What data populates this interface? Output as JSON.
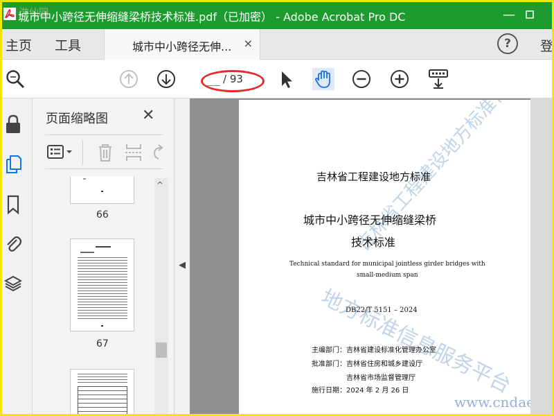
{
  "window": {
    "title": "城市中小跨径无伸缩缝梁桥技术标准.pdf（已加密） - Adobe Acrobat Pro DC",
    "minimize_icon": "minimize-icon",
    "maximize_icon": "maximize-icon",
    "overlay_watermark": "游仙园"
  },
  "menu": {
    "home": "主页",
    "tools": "工具",
    "tab_title": "城市中小跨径无伸...",
    "tab_close": "×",
    "help": "?",
    "login": "登"
  },
  "toolbar": {
    "page_current": "",
    "page_total": "/ 93",
    "icons": [
      "search-icon",
      "prev-page-icon",
      "next-page-icon",
      "select-arrow-icon",
      "hand-tool-icon",
      "zoom-out-icon",
      "zoom-in-icon",
      "keyboard-scroll-icon"
    ]
  },
  "rail": {
    "icons": [
      "lock-icon",
      "pages-icon",
      "bookmark-icon",
      "attachment-icon",
      "layers-icon"
    ],
    "active": "pages-icon"
  },
  "thumbnails": {
    "title": "页面缩略图",
    "close": "✕",
    "pages": [
      {
        "label": "66"
      },
      {
        "label": "67"
      },
      {
        "label": ""
      }
    ]
  },
  "document": {
    "org_title": "吉林省工程建设地方标准",
    "title_line1": "城市中小跨径无伸缩缝梁桥",
    "title_line2": "技术标准",
    "en_line1": "Technical standard for municipal jointless girder bridges with",
    "en_line2": "small-medium span",
    "code": "DB22/T 5151 – 2024",
    "editor": "主编部门：吉林省建设标准化管理办公室",
    "approver": "批准部门：吉林省住房和城乡建设厅",
    "approver2": "吉林省市场监督管理厅",
    "date": "施行日期：2024 年 2 月 26 日",
    "watermark_diag1": "吉林省工程建设地方标准化公开",
    "watermark_diag2": "地方标准信息服务平台",
    "watermark_url": "www.cndae"
  },
  "colors": {
    "titlebar": "#1e9b2f",
    "frame": "#f3e600",
    "highlight": "#e52b2b",
    "accent": "#1473e6"
  }
}
